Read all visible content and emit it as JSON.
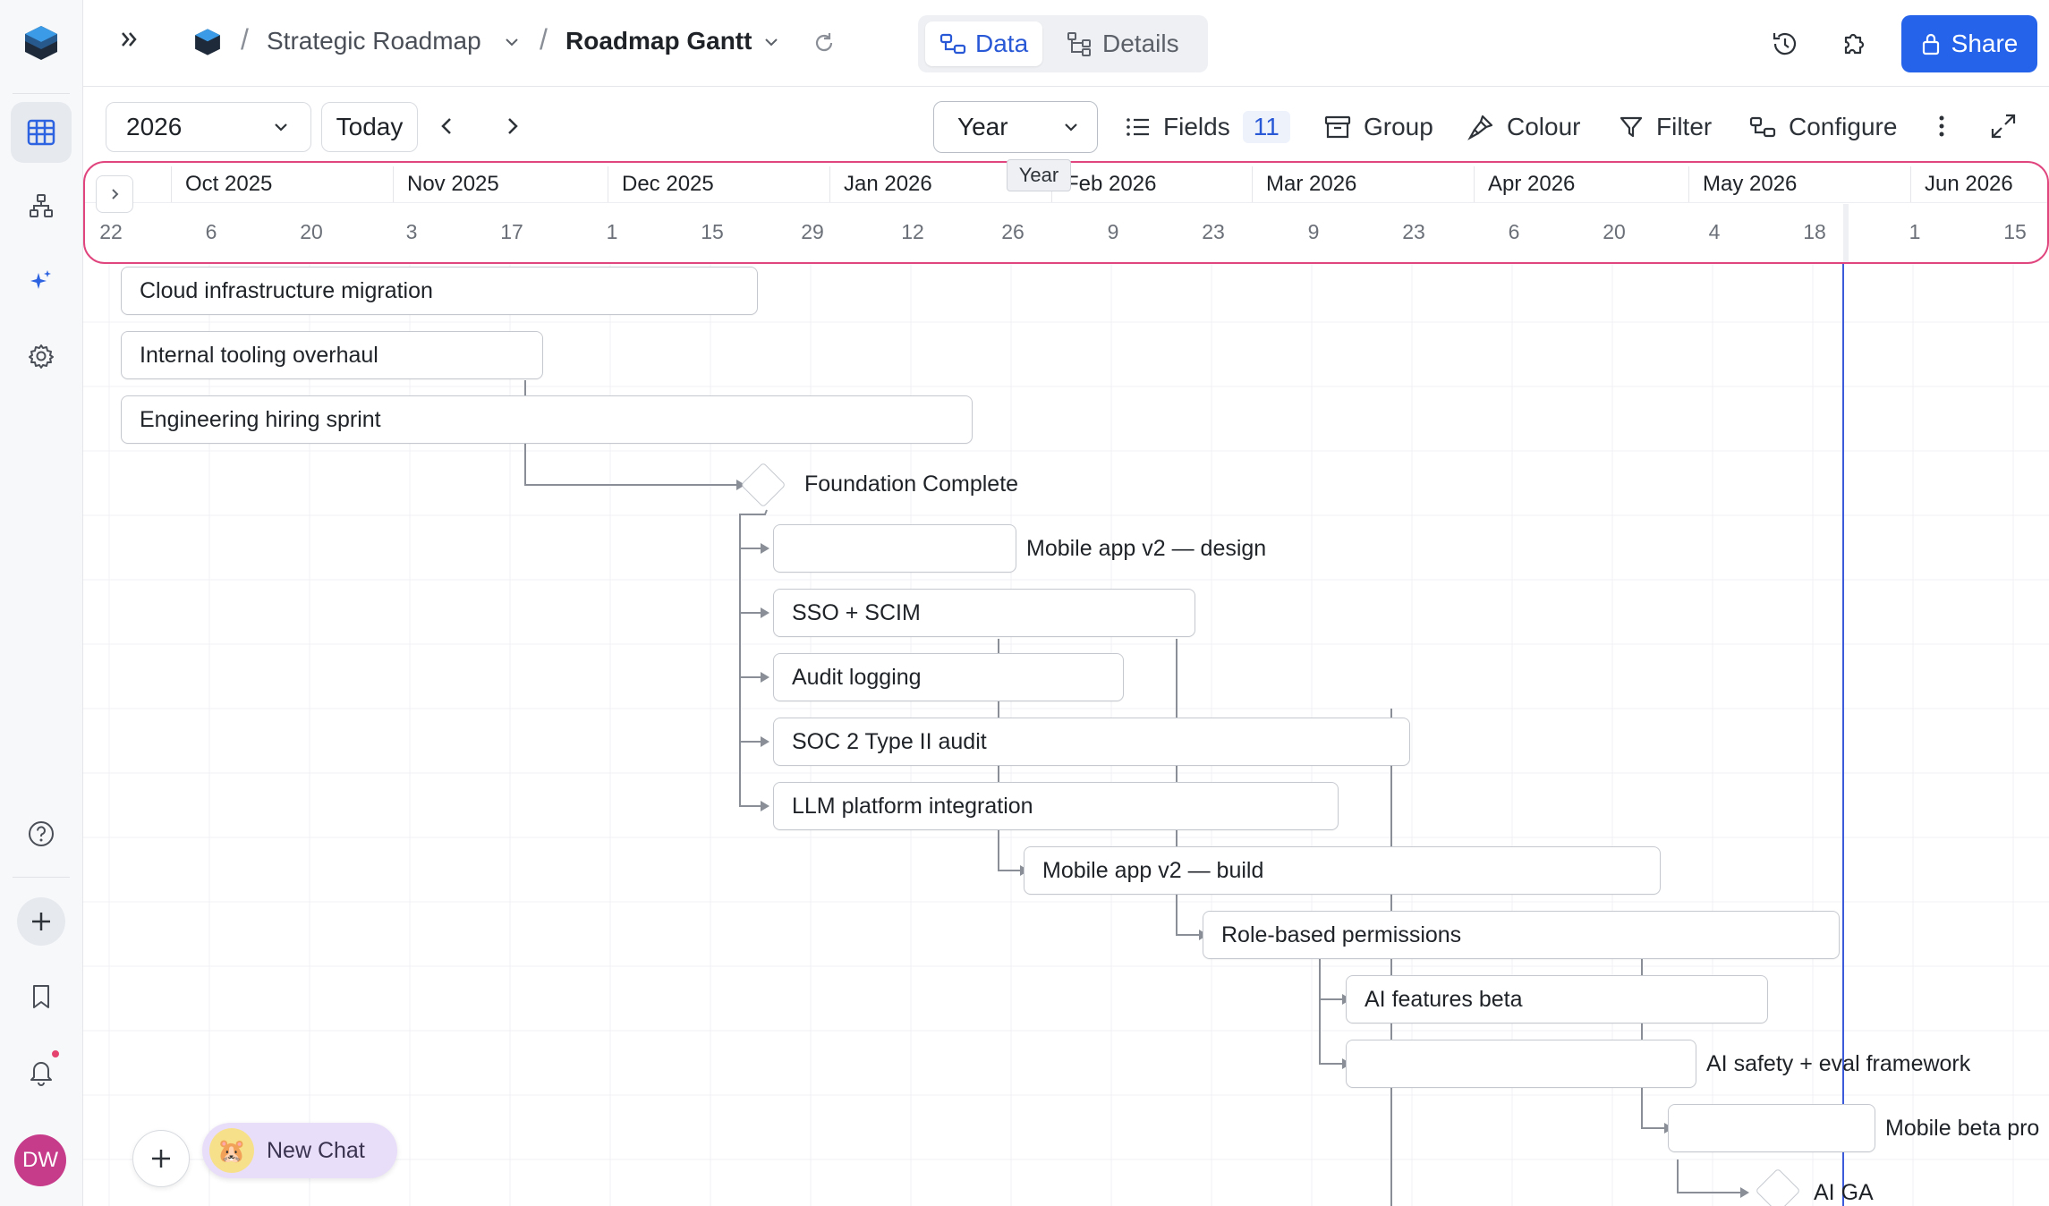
{
  "header": {
    "breadcrumb_project": "Strategic Roadmap",
    "breadcrumb_view": "Roadmap Gantt",
    "tab_data": "Data",
    "tab_details": "Details",
    "share_label": "Share"
  },
  "toolbar": {
    "year_value": "2026",
    "today_label": "Today",
    "scale_value": "Year",
    "scale_tooltip": "Year",
    "fields_label": "Fields",
    "fields_count": "11",
    "group_label": "Group",
    "colour_label": "Colour",
    "filter_label": "Filter",
    "configure_label": "Configure"
  },
  "timeline": {
    "months": [
      "Oct 2025",
      "Nov 2025",
      "Dec 2025",
      "Jan 2026",
      "Feb 2026",
      "Mar 2026",
      "Apr 2026",
      "May 2026",
      "Jun 2026"
    ],
    "days": [
      "22",
      "6",
      "20",
      "3",
      "17",
      "1",
      "15",
      "29",
      "12",
      "26",
      "9",
      "23",
      "9",
      "23",
      "6",
      "20",
      "4",
      "18",
      "1",
      "15"
    ]
  },
  "tasks": [
    {
      "name": "Cloud infrastructure migration"
    },
    {
      "name": "Internal tooling overhaul"
    },
    {
      "name": "Engineering hiring sprint"
    },
    {
      "name": "Foundation Complete"
    },
    {
      "name": "Mobile app v2 — design"
    },
    {
      "name": "SSO + SCIM"
    },
    {
      "name": "Audit logging"
    },
    {
      "name": "SOC 2 Type II audit"
    },
    {
      "name": "LLM platform integration"
    },
    {
      "name": "Mobile app v2 — build"
    },
    {
      "name": "Role-based permissions"
    },
    {
      "name": "AI features beta"
    },
    {
      "name": "AI safety + eval framework"
    },
    {
      "name": "Mobile beta pro"
    },
    {
      "name": "AI GA"
    }
  ],
  "chat": {
    "new_chat_label": "New Chat"
  },
  "user": {
    "initials": "DW"
  },
  "colors": {
    "accent": "#2563eb",
    "timeline_outline": "#e0457e",
    "today_line": "#3b5bdb",
    "avatar": "#c63c8a"
  }
}
